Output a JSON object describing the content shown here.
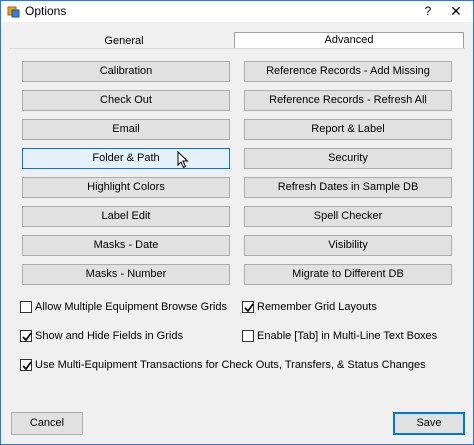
{
  "window": {
    "title": "Options",
    "help_label": "?",
    "close_label": "✕"
  },
  "tabs": [
    {
      "label": "General",
      "selected": false
    },
    {
      "label": "Advanced",
      "selected": true
    }
  ],
  "buttons_left": [
    "Calibration",
    "Check Out",
    "Email",
    "Folder & Path",
    "Highlight Colors",
    "Label Edit",
    "Masks - Date",
    "Masks - Number"
  ],
  "buttons_right": [
    "Reference Records - Add Missing",
    "Reference Records - Refresh All",
    "Report & Label",
    "Security",
    "Refresh Dates in Sample DB",
    "Spell Checker",
    "Visibility",
    "Migrate to Different DB"
  ],
  "checkboxes": [
    {
      "label": "Allow Multiple Equipment Browse Grids",
      "checked": false
    },
    {
      "label": "Remember Grid Layouts",
      "checked": true
    },
    {
      "label": "Show and Hide Fields in Grids",
      "checked": true
    },
    {
      "label": "Enable [Tab] in Multi-Line Text Boxes",
      "checked": false
    },
    {
      "label": "Use Multi-Equipment Transactions for Check Outs, Transfers, & Status Changes",
      "checked": true
    }
  ],
  "footer": {
    "cancel_label": "Cancel",
    "save_label": "Save"
  },
  "colors": {
    "accent": "#0078d7",
    "button_face": "#e1e1e1",
    "window_bg": "#f0f0f0"
  }
}
